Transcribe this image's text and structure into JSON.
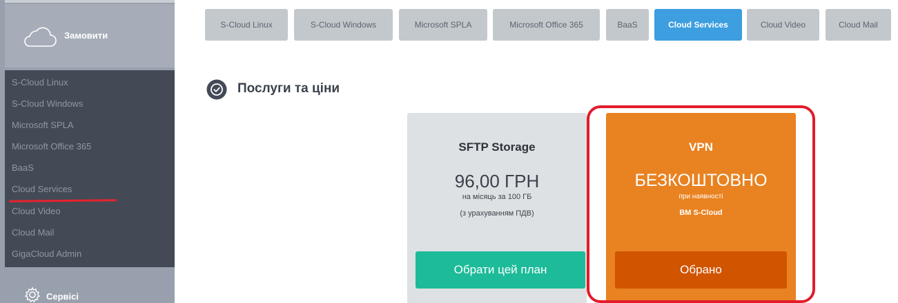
{
  "sidebar": {
    "order_label": "Замовити",
    "items": [
      {
        "label": "S-Cloud Linux"
      },
      {
        "label": "S-Cloud Windows"
      },
      {
        "label": "Microsoft SPLA"
      },
      {
        "label": "Microsoft Office 365"
      },
      {
        "label": "BaaS"
      },
      {
        "label": "Cloud Services"
      },
      {
        "label": "Cloud Video"
      },
      {
        "label": "Cloud Mail"
      },
      {
        "label": "GigaCloud Admin"
      }
    ],
    "services_label": "Сервісі"
  },
  "tabs": [
    {
      "label": "S-Cloud Linux"
    },
    {
      "label": "S-Cloud Windows"
    },
    {
      "label": "Microsoft SPLA"
    },
    {
      "label": "Microsoft Office 365"
    },
    {
      "label": "BaaS"
    },
    {
      "label": "Cloud Services",
      "active": true
    },
    {
      "label": "Cloud Video"
    },
    {
      "label": "Cloud Mail"
    }
  ],
  "section": {
    "title": "Послуги та ціни"
  },
  "plans": [
    {
      "title": "SFTP Storage",
      "price": "96,00 ГРН",
      "note1": "на місяць за 100 ГБ",
      "note2": "(з урахуванням ПДВ)",
      "button": "Обрати цей план"
    },
    {
      "title": "VPN",
      "price": "БЕЗКОШТОВНО",
      "note1": "при наявності",
      "note2": "ВМ S-Cloud",
      "button": "Обрано"
    }
  ],
  "colors": {
    "accent_blue": "#3d9ee0",
    "teal_button": "#1dbb99",
    "orange_card": "#e98221",
    "chosen_button": "#d15400",
    "highlight_red": "#e21b2b"
  },
  "icons": {
    "order": "cloud-icon",
    "services": "gear-icon",
    "section": "check-circle-icon"
  }
}
